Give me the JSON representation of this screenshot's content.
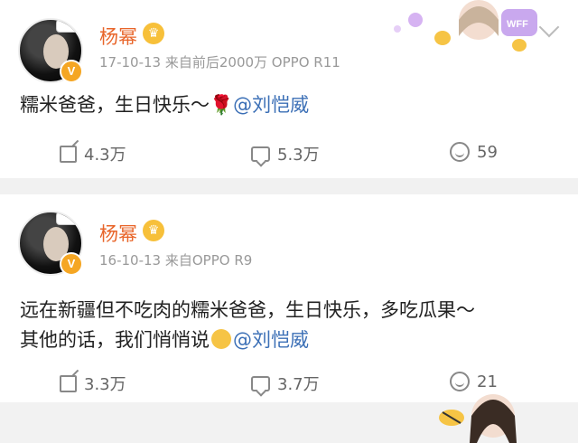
{
  "posts": [
    {
      "author": "杨幂",
      "meta": "17-10-13 来自前后2000万 OPPO R11",
      "text_main": "糯米爸爸，生日快乐～",
      "mention": "@刘恺威",
      "actions": {
        "repost": "4.3万",
        "comment": "5.3万",
        "like": "59"
      }
    },
    {
      "author": "杨幂",
      "meta": "16-10-13 来自OPPO R9",
      "text_line1": "远在新疆但不吃肉的糯米爸爸，生日快乐，多吃瓜果～",
      "text_line2": "其他的话，我们悄悄说",
      "mention": "@刘恺威",
      "actions": {
        "repost": "3.3万",
        "comment": "3.7万",
        "like": "21"
      }
    }
  ],
  "badges": {
    "verified": "V"
  },
  "decor": {
    "card_text": "WFF"
  },
  "colors": {
    "name": "#e8652a",
    "mention": "#3b6fb6",
    "badge": "#f5a623"
  }
}
